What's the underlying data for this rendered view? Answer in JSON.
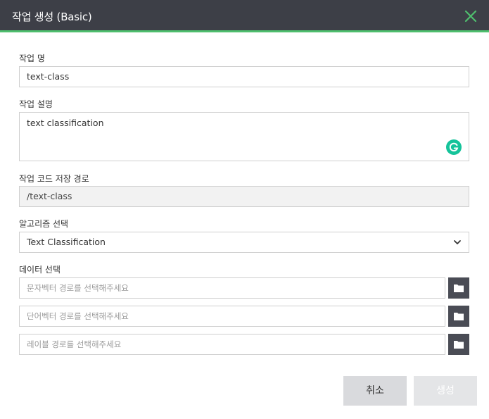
{
  "dialog": {
    "title": "작업 생성 (Basic)"
  },
  "form": {
    "job_name": {
      "label": "작업 명",
      "value": "text-class"
    },
    "job_description": {
      "label": "작업 설명",
      "value": "text classification"
    },
    "code_path": {
      "label": "작업 코드 저장 경로",
      "value": "/text-class"
    },
    "algorithm": {
      "label": "알고리즘 선택",
      "selected": "Text Classification"
    },
    "data": {
      "label": "데이터 선택",
      "fields": [
        {
          "placeholder": "문자벡터 경로를 선택해주세요"
        },
        {
          "placeholder": "단어벡터 경로를 선택해주세요"
        },
        {
          "placeholder": "레이블 경로를 선택해주세요"
        }
      ]
    }
  },
  "buttons": {
    "cancel": "취소",
    "create": "생성"
  },
  "colors": {
    "header_bg": "#3d3f47",
    "accent": "#4fbf6e",
    "grammarly": "#15c39a",
    "folder_button": "#4a4c55"
  }
}
